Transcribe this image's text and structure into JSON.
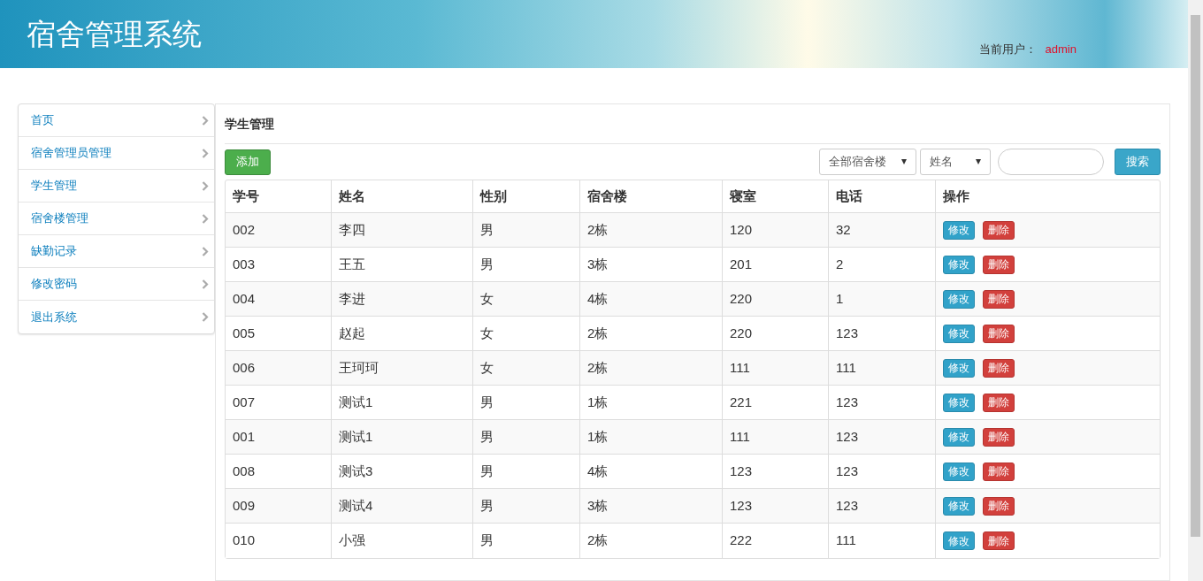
{
  "header": {
    "title": "宿舍管理系统",
    "user_label": "当前用户：",
    "user_name": "admin"
  },
  "sidebar": {
    "items": [
      {
        "label": "首页"
      },
      {
        "label": "宿舍管理员管理"
      },
      {
        "label": "学生管理"
      },
      {
        "label": "宿舍楼管理"
      },
      {
        "label": "缺勤记录"
      },
      {
        "label": "修改密码"
      },
      {
        "label": "退出系统"
      }
    ]
  },
  "panel": {
    "title": "学生管理",
    "add_button": "添加",
    "building_select": "全部宿舍楼",
    "field_select": "姓名",
    "search_button": "搜索"
  },
  "table": {
    "columns": [
      "学号",
      "姓名",
      "性别",
      "宿舍楼",
      "寝室",
      "电话",
      "操作"
    ],
    "rows": [
      {
        "cells": [
          "002",
          "李四",
          "男",
          "2栋",
          "120",
          "32"
        ],
        "actions": [
          {
            "kind": "edit",
            "label": "修改"
          },
          {
            "kind": "delete",
            "label": "删除"
          }
        ]
      },
      {
        "cells": [
          "003",
          "王五",
          "男",
          "3栋",
          "201",
          "2"
        ],
        "actions": [
          {
            "kind": "edit",
            "label": "修改"
          },
          {
            "kind": "delete",
            "label": "删除"
          }
        ]
      },
      {
        "cells": [
          "004",
          "李进",
          "女",
          "4栋",
          "220",
          "1"
        ],
        "actions": [
          {
            "kind": "edit",
            "label": "修改"
          },
          {
            "kind": "delete",
            "label": "删除"
          }
        ]
      },
      {
        "cells": [
          "005",
          "赵起",
          "女",
          "2栋",
          "220",
          "123"
        ],
        "actions": [
          {
            "kind": "edit",
            "label": "修改"
          },
          {
            "kind": "delete",
            "label": "删除"
          }
        ]
      },
      {
        "cells": [
          "006",
          "王珂珂",
          "女",
          "2栋",
          "111",
          "111"
        ],
        "actions": [
          {
            "kind": "edit",
            "label": "修改"
          },
          {
            "kind": "delete",
            "label": "删除"
          }
        ]
      },
      {
        "cells": [
          "007",
          "测试1",
          "男",
          "1栋",
          "221",
          "123"
        ],
        "actions": [
          {
            "kind": "edit",
            "label": "修改"
          },
          {
            "kind": "delete",
            "label": "删除"
          }
        ]
      },
      {
        "cells": [
          "001",
          "测试1",
          "男",
          "1栋",
          "111",
          "123"
        ],
        "actions": [
          {
            "kind": "edit",
            "label": "修改"
          },
          {
            "kind": "delete",
            "label": "删除"
          }
        ]
      },
      {
        "cells": [
          "008",
          "测试3",
          "男",
          "4栋",
          "123",
          "123"
        ],
        "actions": [
          {
            "kind": "edit",
            "label": "修改"
          },
          {
            "kind": "delete",
            "label": "删除"
          }
        ]
      },
      {
        "cells": [
          "009",
          "测试4",
          "男",
          "3栋",
          "123",
          "123"
        ],
        "actions": [
          {
            "kind": "edit",
            "label": "修改"
          },
          {
            "kind": "delete",
            "label": "删除"
          }
        ]
      },
      {
        "cells": [
          "010",
          "小强",
          "男",
          "2栋",
          "222",
          "111"
        ],
        "actions": [
          {
            "kind": "edit",
            "label": "修改"
          },
          {
            "kind": "delete",
            "label": "删除"
          }
        ]
      }
    ]
  }
}
